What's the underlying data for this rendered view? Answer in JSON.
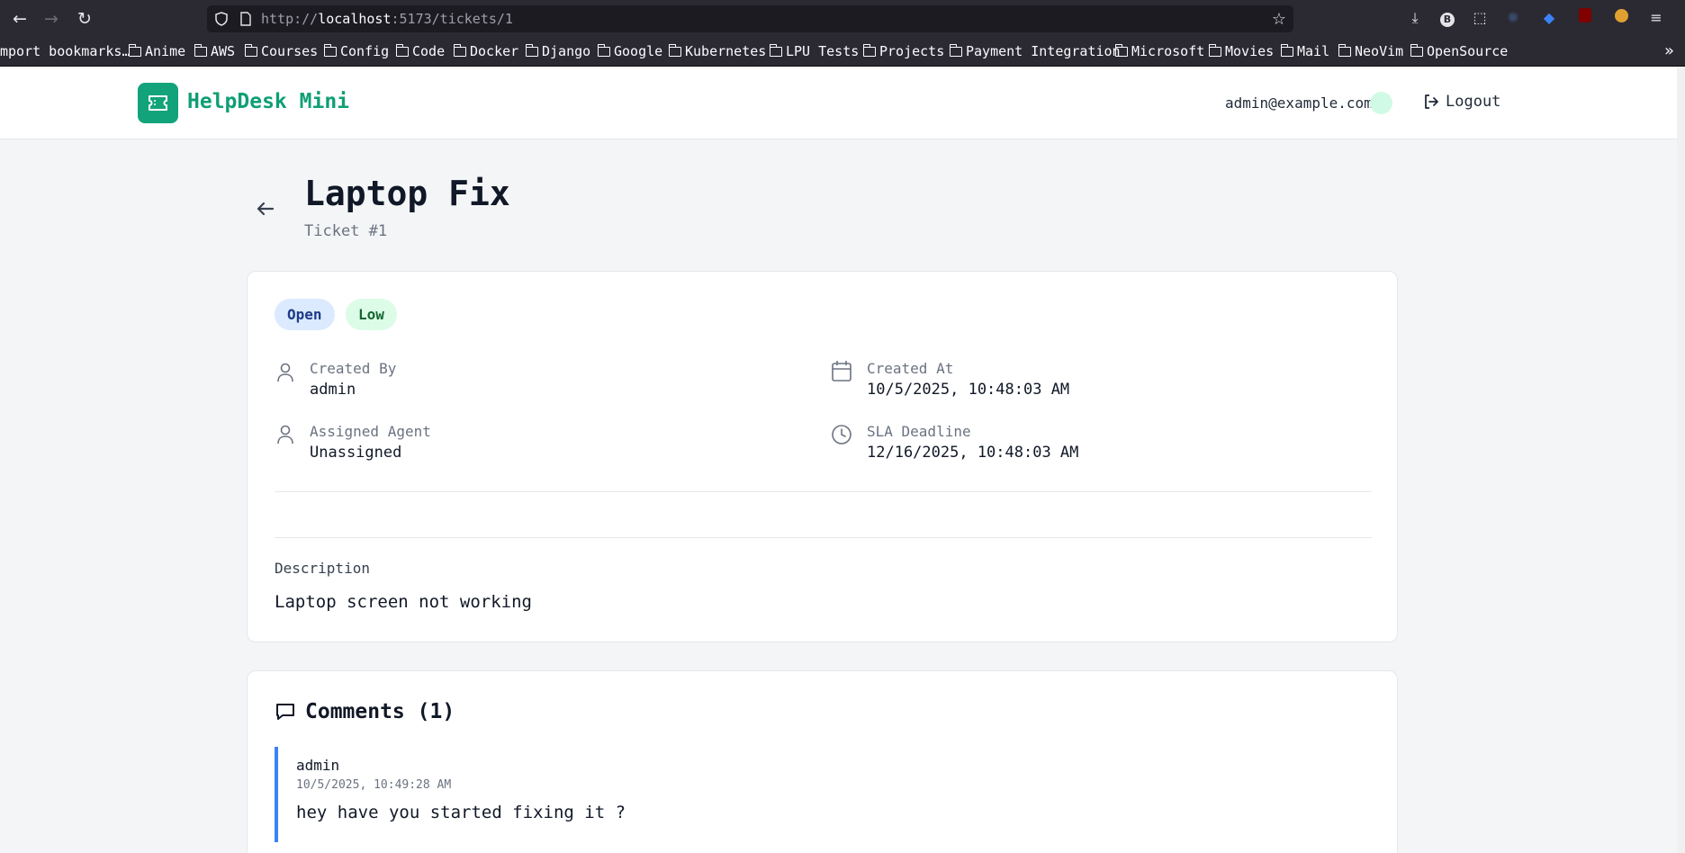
{
  "browser": {
    "url_prefix": "http://",
    "url_host": "localhost",
    "url_rest": ":5173/tickets/1",
    "bookmarks": [
      {
        "label": "mport bookmarks…",
        "folder": false
      },
      {
        "label": "Anime",
        "folder": true
      },
      {
        "label": "AWS",
        "folder": true
      },
      {
        "label": "Courses",
        "folder": true
      },
      {
        "label": "Config",
        "folder": true
      },
      {
        "label": "Code",
        "folder": true
      },
      {
        "label": "Docker",
        "folder": true
      },
      {
        "label": "Django",
        "folder": true
      },
      {
        "label": "Google",
        "folder": true
      },
      {
        "label": "Kubernetes",
        "folder": true
      },
      {
        "label": "LPU Tests",
        "folder": true
      },
      {
        "label": "Projects",
        "folder": true
      },
      {
        "label": "Payment Integration",
        "folder": true
      },
      {
        "label": "Microsoft",
        "folder": true
      },
      {
        "label": "Movies",
        "folder": true
      },
      {
        "label": "Mail",
        "folder": true
      },
      {
        "label": "NeoVim",
        "folder": true
      },
      {
        "label": "OpenSource",
        "folder": true
      }
    ]
  },
  "header": {
    "brand": "HelpDesk Mini",
    "user_email": "admin@example.com",
    "logout_label": "Logout"
  },
  "ticket": {
    "title": "Laptop Fix",
    "subtitle": "Ticket #1",
    "status": "Open",
    "priority": "Low",
    "created_by_label": "Created By",
    "created_by": "admin",
    "created_at_label": "Created At",
    "created_at": "10/5/2025, 10:48:03 AM",
    "assigned_label": "Assigned Agent",
    "assigned": "Unassigned",
    "sla_label": "SLA Deadline",
    "sla": "12/16/2025, 10:48:03 AM",
    "description_label": "Description",
    "description": "Laptop screen not working"
  },
  "comments": {
    "title": "Comments (1)",
    "items": [
      {
        "author": "admin",
        "time": "10/5/2025, 10:49:28 AM",
        "body": "hey have you started fixing it ?"
      }
    ]
  },
  "colors": {
    "brand": "#12a37a",
    "status_bg": "#dbeafe",
    "priority_bg": "#dcfce7",
    "comment_accent": "#3b82f6"
  }
}
